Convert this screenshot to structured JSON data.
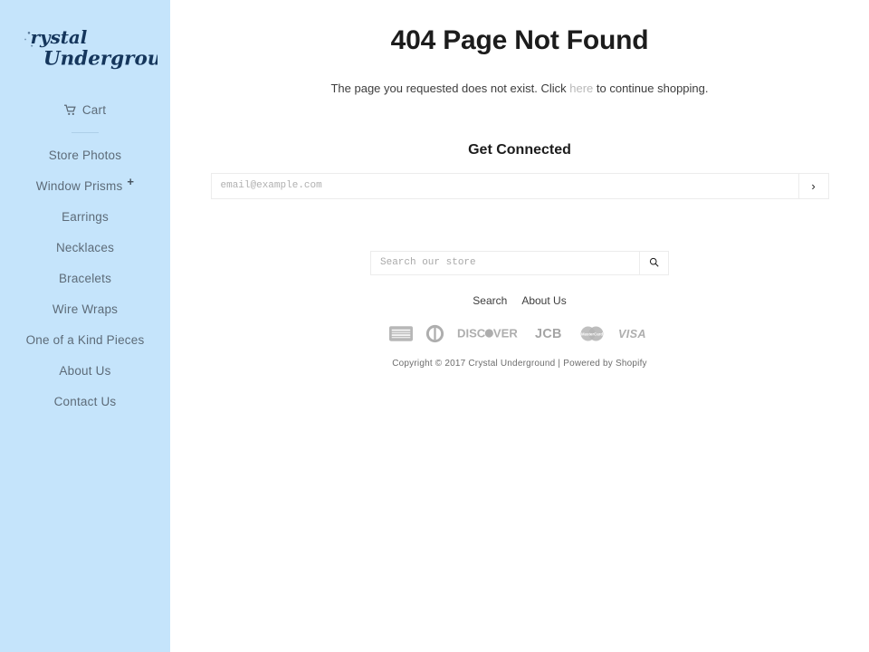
{
  "colors": {
    "sidebar_bg": "#c5e4fb",
    "main_bg": "#ffffff",
    "nav_text": "#5d6b78",
    "heading": "#1c1c1c",
    "link_muted": "#b9b9b9"
  },
  "sidebar": {
    "logo_text_line1": "Crystal",
    "logo_text_line2": "Underground",
    "logo_alt": "Crystal Underground",
    "cart": {
      "label": "Cart",
      "icon": "shopping-cart-icon"
    },
    "items": [
      {
        "label": "Store Photos",
        "expandable": false
      },
      {
        "label": "Window Prisms",
        "expandable": true,
        "expand_glyph": "+"
      },
      {
        "label": "Earrings",
        "expandable": false
      },
      {
        "label": "Necklaces",
        "expandable": false
      },
      {
        "label": "Bracelets",
        "expandable": false
      },
      {
        "label": "Wire Wraps",
        "expandable": false
      },
      {
        "label": "One of a Kind Pieces",
        "expandable": false
      },
      {
        "label": "About Us",
        "expandable": false
      },
      {
        "label": "Contact Us",
        "expandable": false
      }
    ]
  },
  "main": {
    "title": "404 Page Not Found",
    "message_before": "The page you requested does not exist. Click ",
    "message_link": "here",
    "message_after": " to continue shopping.",
    "newsletter": {
      "heading": "Get Connected",
      "placeholder": "email@example.com",
      "value": "",
      "submit_glyph": "›",
      "submit_name": "subscribe-button"
    },
    "search": {
      "placeholder": "Search our store",
      "value": "",
      "submit_icon": "search-icon"
    },
    "footer_links": [
      {
        "label": "Search"
      },
      {
        "label": "About Us"
      }
    ],
    "payment_methods": [
      {
        "name": "american-express",
        "label": "American Express"
      },
      {
        "name": "diners-club",
        "label": "Diners Club"
      },
      {
        "name": "discover",
        "label": "DISCOVER"
      },
      {
        "name": "jcb",
        "label": "JCB"
      },
      {
        "name": "mastercard",
        "label": "Mastercard"
      },
      {
        "name": "visa",
        "label": "VISA"
      }
    ],
    "copyright": "Copyright © 2017 Crystal Underground | Powered by Shopify"
  }
}
